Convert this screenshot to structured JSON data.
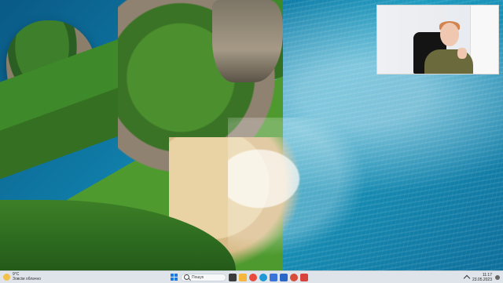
{
  "taskbar": {
    "weather": {
      "temp": "9°C",
      "condition": "Зовсім облачно"
    },
    "search": {
      "placeholder": "Пошук"
    },
    "apps": [
      {
        "name": "task-view-icon",
        "color": "#3b3b3b"
      },
      {
        "name": "file-explorer-icon",
        "color": "#f5b73d"
      },
      {
        "name": "chrome-icon",
        "color": "#e74c3c"
      },
      {
        "name": "edge-icon",
        "color": "#1f9ad6"
      },
      {
        "name": "store-icon",
        "color": "#3a74d9"
      },
      {
        "name": "mail-icon",
        "color": "#2a66c7"
      },
      {
        "name": "chrome-icon",
        "color": "#d94b3b"
      },
      {
        "name": "app-icon",
        "color": "#d8443b"
      }
    ],
    "clock": {
      "time": "11:17",
      "date": "23.05.2023"
    }
  },
  "colors": {
    "accent": "#1f7ae0",
    "taskbar_bg": "#dfe4ea"
  }
}
